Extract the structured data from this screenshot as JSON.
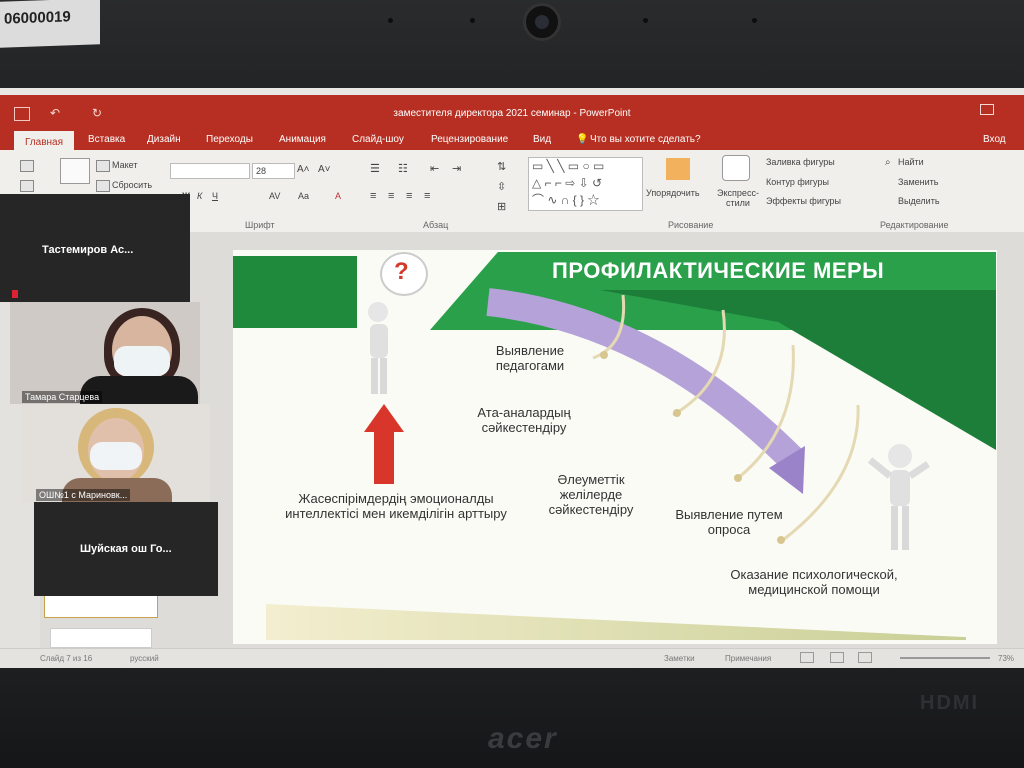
{
  "photo": {
    "sticker_text": "06000019",
    "laptop_brand": "acer",
    "port_label": "HDMI"
  },
  "window": {
    "title": "заместителя директора 2021 семинар - PowerPoint",
    "signin": "Вход"
  },
  "ribbon": {
    "tabs": [
      "Главная",
      "Вставка",
      "Дизайн",
      "Переходы",
      "Анимация",
      "Слайд-шоу",
      "Рецензирование",
      "Вид"
    ],
    "tell_me": "Что вы хотите сделать?",
    "layout_label": "Макет",
    "reset_label": "Сбросить",
    "font_size": "28",
    "groups": {
      "font": "Шрифт",
      "paragraph": "Абзац",
      "drawing": "Рисование",
      "editing": "Редактирование"
    },
    "arrange": "Упорядочить",
    "quick_styles": "Экспресс-стили",
    "shape_fill": "Заливка фигуры",
    "shape_outline": "Контур фигуры",
    "shape_effects": "Эффекты фигуры",
    "find": "Найти",
    "replace": "Заменить",
    "select": "Выделить"
  },
  "slide": {
    "title": "ПРОФИЛАКТИЧЕСКИЕ МЕРЫ",
    "items": [
      "Выявление педагогами",
      "Ата-аналардың сәйкестендіру",
      "Әлеуметтік желілерде сәйкестендіру",
      "Выявление путем опроса",
      "Оказание психологической, медицинской помощи",
      "Жасөспірімдердің эмоционалды интеллектісі мен икемділігін арттыру"
    ]
  },
  "status": {
    "slide_counter": "Слайд 7 из 16",
    "language": "русский",
    "notes": "Заметки",
    "comments": "Примечания",
    "zoom": "73%"
  },
  "video_call": {
    "participants": [
      "Тастемиров Ас...",
      "Тамара Старцева",
      "ОШ№1 с Мариновк...",
      "Шуйская ош Го..."
    ]
  }
}
